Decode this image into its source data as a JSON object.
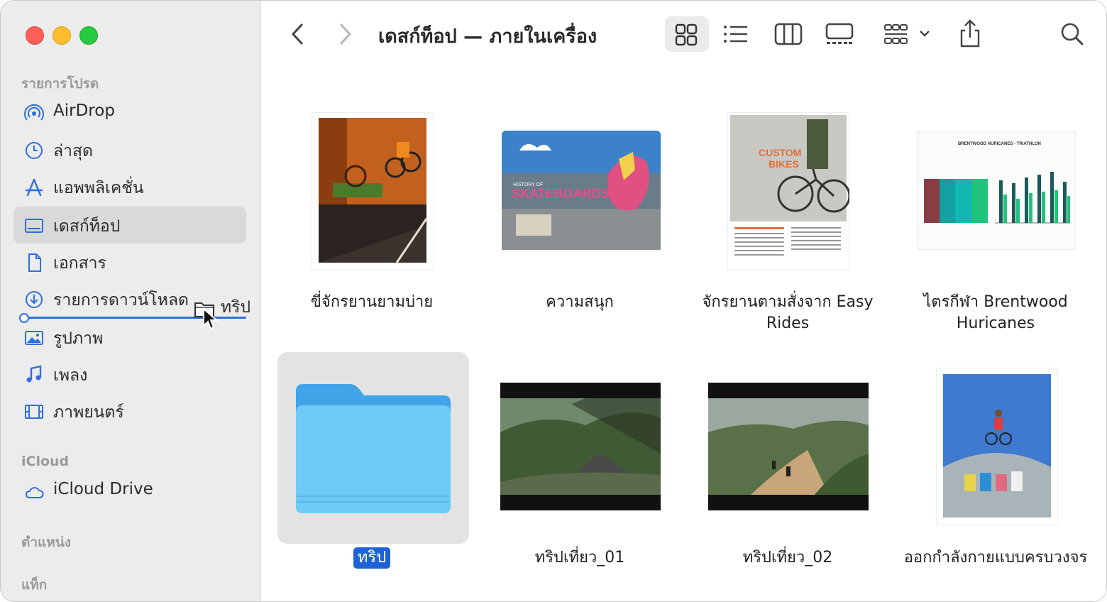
{
  "window": {
    "title": "เดสก์ท็อป — ภายในเครื่อง"
  },
  "sidebar": {
    "favorites_header": "รายการโปรด",
    "items": [
      {
        "label": "AirDrop",
        "icon": "airdrop-icon"
      },
      {
        "label": "ล่าสุด",
        "icon": "clock-icon"
      },
      {
        "label": "แอพพลิเคชั่น",
        "icon": "applications-icon"
      },
      {
        "label": "เดสก์ท็อป",
        "icon": "desktop-icon",
        "selected": true
      },
      {
        "label": "เอกสาร",
        "icon": "document-icon"
      },
      {
        "label": "รายการดาวน์โหลด",
        "icon": "download-icon"
      },
      {
        "label": "รูปภาพ",
        "icon": "photo-icon"
      },
      {
        "label": "เพลง",
        "icon": "music-icon"
      },
      {
        "label": "ภาพยนตร์",
        "icon": "film-icon"
      }
    ],
    "icloud_header": "iCloud",
    "icloud_items": [
      {
        "label": "iCloud Drive",
        "icon": "cloud-icon"
      }
    ],
    "locations_header": "ตำแหน่ง",
    "tags_header": "แท็ก",
    "drag_label": "ทริป"
  },
  "toolbar": {
    "icons": [
      "back-icon",
      "forward-icon",
      "icon-view-icon",
      "list-view-icon",
      "column-view-icon",
      "gallery-view-icon",
      "group-icon",
      "share-icon",
      "search-icon"
    ]
  },
  "files": [
    {
      "name": "ขี่จักรยานยามบ่าย"
    },
    {
      "name": "ความสนุก"
    },
    {
      "name": "จักรยานตามสั่งจาก Easy Rides"
    },
    {
      "name": "ไตรกีฬา Brentwood Huricanes"
    },
    {
      "name": "ทริป",
      "selected": true
    },
    {
      "name": "ทริปเที่ยว_01"
    },
    {
      "name": "ทริปเที่ยว_02"
    },
    {
      "name": "ออกกำลังกายแบบครบวงจร"
    }
  ],
  "thumb_text": {
    "skateboards": "SKATEBOARDS",
    "skate_small": "HISTORY OF",
    "custom": "CUSTOM",
    "bikes": "BIKES",
    "triathlon": "BRENTWOOD HURICANES - TRIATHLON"
  },
  "colors": {
    "accent": "#1f62d8",
    "drop_line": "#2f6ee0",
    "folder": "#6ecbf5"
  }
}
